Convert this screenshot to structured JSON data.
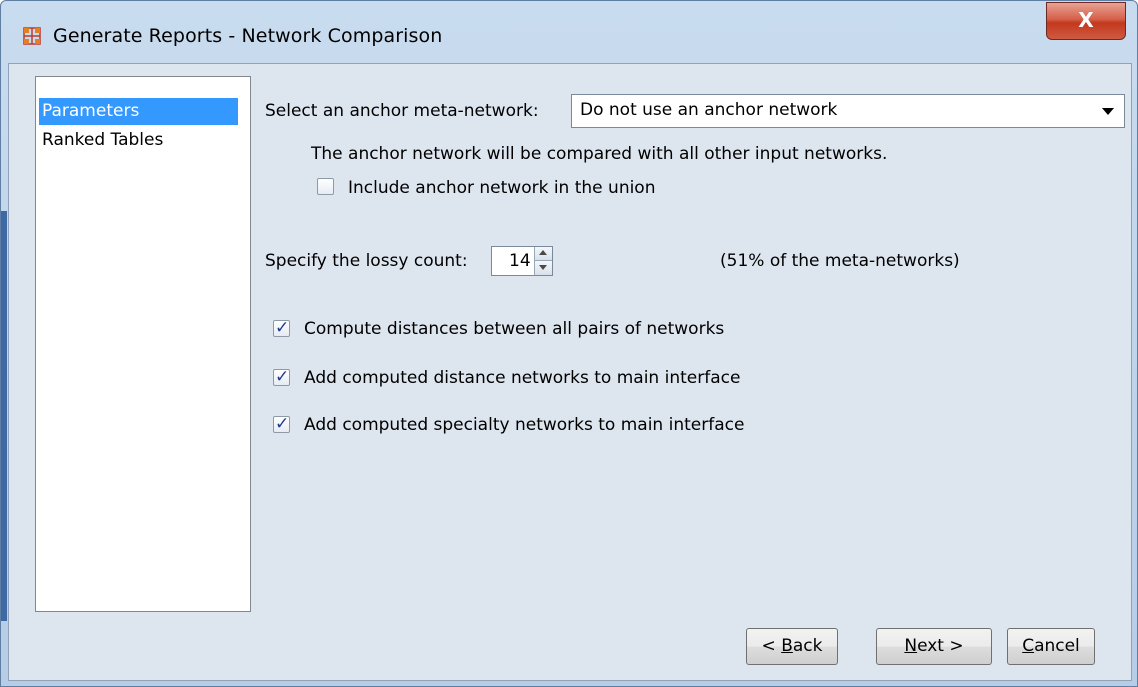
{
  "window": {
    "title": "Generate Reports - Network Comparison",
    "icon": "network-grid-icon",
    "close_icon": "close-x-icon",
    "close_label": "X"
  },
  "nav": {
    "items": [
      {
        "label": "Parameters",
        "selected": true
      },
      {
        "label": "Ranked Tables",
        "selected": false
      }
    ]
  },
  "params": {
    "anchor_label": "Select an anchor meta-network:",
    "anchor_value": "Do not use an anchor network",
    "anchor_note": "The anchor network will be compared with all other input networks.",
    "include_anchor": {
      "label": "Include anchor network in the union",
      "checked": false
    },
    "lossy_label": "Specify the lossy count:",
    "lossy_value": "14",
    "lossy_pct": "(51% of the meta-networks)",
    "options": [
      {
        "label": "Compute distances between all pairs of networks",
        "checked": true
      },
      {
        "label": "Add computed distance networks to main interface",
        "checked": true
      },
      {
        "label": "Add computed specialty networks to main interface",
        "checked": true
      }
    ]
  },
  "buttons": {
    "back_prefix": "< ",
    "back_mn": "B",
    "back_rest": "ack",
    "next_mn": "N",
    "next_rest": "ext >",
    "cancel_mn": "C",
    "cancel_rest": "ancel"
  },
  "colors": {
    "selection": "#3399ff",
    "close_button": "#c2391f",
    "dialog_bg": "#dde5ef"
  }
}
